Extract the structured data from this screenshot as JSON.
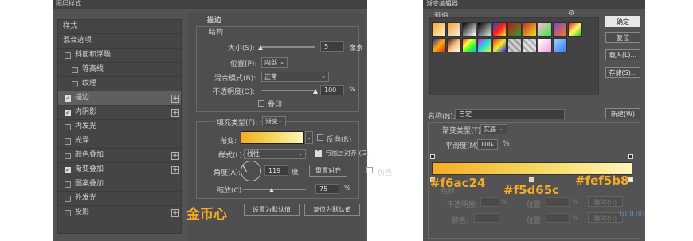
{
  "left_dialog": {
    "title": "图层样式",
    "styles_header": "样式",
    "blend_options": "混合选项",
    "items": [
      {
        "label": "斜面和浮雕",
        "checked": false
      },
      {
        "label": "等高线",
        "checked": false
      },
      {
        "label": "纹理",
        "checked": false
      },
      {
        "label": "描边",
        "checked": true
      },
      {
        "label": "内阴影",
        "checked": true
      },
      {
        "label": "内发光",
        "checked": false
      },
      {
        "label": "光泽",
        "checked": false
      },
      {
        "label": "颜色叠加",
        "checked": false
      },
      {
        "label": "渐变叠加",
        "checked": true
      },
      {
        "label": "图案叠加",
        "checked": false
      },
      {
        "label": "外发光",
        "checked": false
      },
      {
        "label": "投影",
        "checked": false
      }
    ],
    "stroke": {
      "section": "描边",
      "structure": "结构",
      "size_label": "大小(S):",
      "size_value": "5",
      "size_unit": "像素",
      "position_label": "位置(P):",
      "position_value": "内部",
      "blend_label": "混合模式(B):",
      "blend_value": "正常",
      "opacity_label": "不透明度(O):",
      "opacity_value": "100",
      "opacity_unit": "%",
      "overprint_label": "叠印",
      "fill_type_label": "填充类型(F):",
      "fill_type_value": "渐变",
      "gradient_label": "渐变:",
      "reverse_label": "反向(R)",
      "style_label": "样式(L):",
      "style_value": "线性",
      "align_label": "与图层对齐 (G)",
      "angle_label": "角度(A):",
      "angle_value": "119",
      "angle_unit": "度",
      "reset_align": "重置对齐",
      "dither_label": "仿色",
      "scale_label": "缩放(C):",
      "scale_value": "75",
      "scale_unit": "%",
      "set_default": "设置为默认值",
      "reset_default": "复位为默认值"
    }
  },
  "annotation": {
    "gold_coin": "金币心",
    "colors": [
      "#f6ac24",
      "#f5d65c",
      "#fef5b8"
    ]
  },
  "right_dialog": {
    "title": "渐变编辑器",
    "presets_label": "预设",
    "gear": "⚙",
    "ok": "确定",
    "reset": "复位",
    "load": "载入(L)...",
    "save": "存储(S)...",
    "name_label": "名称(N):",
    "name_value": "自定",
    "new_button": "新建(W)",
    "gradient_type_label": "渐变类型(T):",
    "gradient_type_value": "实底",
    "smoothness_label": "平滑度(M):",
    "smoothness_value": "100",
    "smoothness_unit": "%",
    "color_stops_label": "色标",
    "opacity_label": "不透明度:",
    "position_label": "位置:",
    "pct": "%",
    "delete_label": "删除(D)",
    "color_label": "颜色:",
    "watermark": "UIIIUIII"
  }
}
